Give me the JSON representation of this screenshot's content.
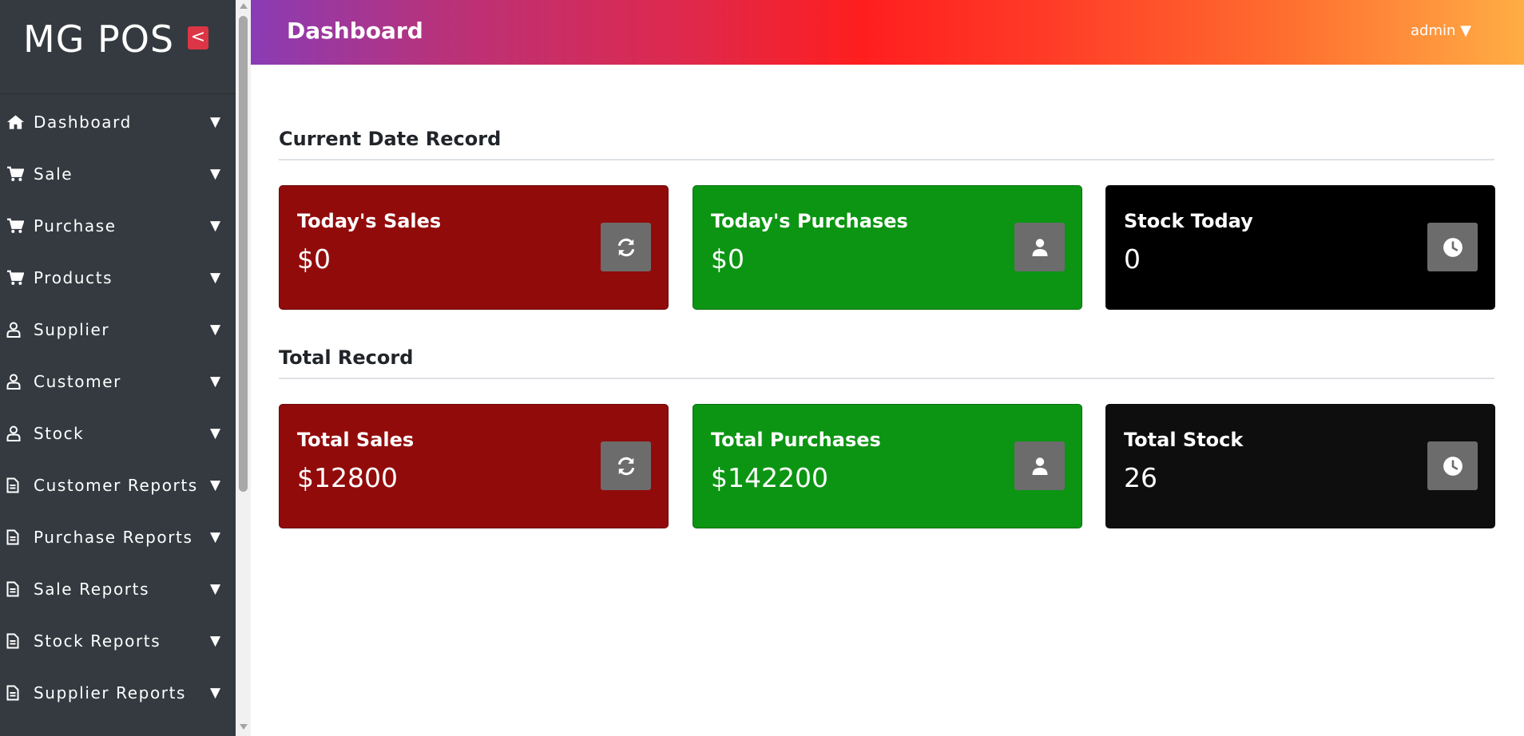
{
  "sidebar": {
    "brand": "MG POS",
    "collapse_label": "<",
    "items": [
      {
        "label": "Dashboard",
        "icon": "home-icon"
      },
      {
        "label": "Sale",
        "icon": "cart-icon"
      },
      {
        "label": "Purchase",
        "icon": "cart-icon"
      },
      {
        "label": "Products",
        "icon": "cart-icon"
      },
      {
        "label": "Supplier",
        "icon": "user-icon"
      },
      {
        "label": "Customer",
        "icon": "user-icon"
      },
      {
        "label": "Stock",
        "icon": "user-icon"
      },
      {
        "label": "Customer Reports",
        "icon": "document-icon"
      },
      {
        "label": "Purchase Reports",
        "icon": "document-icon"
      },
      {
        "label": "Sale Reports",
        "icon": "document-icon"
      },
      {
        "label": "Stock Reports",
        "icon": "document-icon"
      },
      {
        "label": "Supplier Reports",
        "icon": "document-icon"
      }
    ],
    "caret": "▼"
  },
  "header": {
    "title": "Dashboard",
    "user_menu": "admin ▼"
  },
  "sections": {
    "current": {
      "title": "Current Date Record",
      "cards": [
        {
          "label": "Today's Sales",
          "value": "$0",
          "icon": "refresh-icon",
          "color": "#920b0b"
        },
        {
          "label": "Today's Purchases",
          "value": "$0",
          "icon": "user-icon",
          "color": "#0c9513"
        },
        {
          "label": "Stock Today",
          "value": "0",
          "icon": "clock-icon",
          "color": "#000000"
        }
      ]
    },
    "total": {
      "title": "Total Record",
      "cards": [
        {
          "label": "Total Sales",
          "value": "$12800",
          "icon": "refresh-icon",
          "color": "#920b0b"
        },
        {
          "label": "Total Purchases",
          "value": "$142200",
          "icon": "user-icon",
          "color": "#0c9513"
        },
        {
          "label": "Total Stock",
          "value": "26",
          "icon": "clock-icon",
          "color": "#0e0e0e"
        }
      ]
    }
  },
  "colors": {
    "sidebar_bg": "#343a40",
    "accent_red": "#dc3545",
    "card_red": "#920b0b",
    "card_green": "#0c9513",
    "card_black": "#000000"
  }
}
